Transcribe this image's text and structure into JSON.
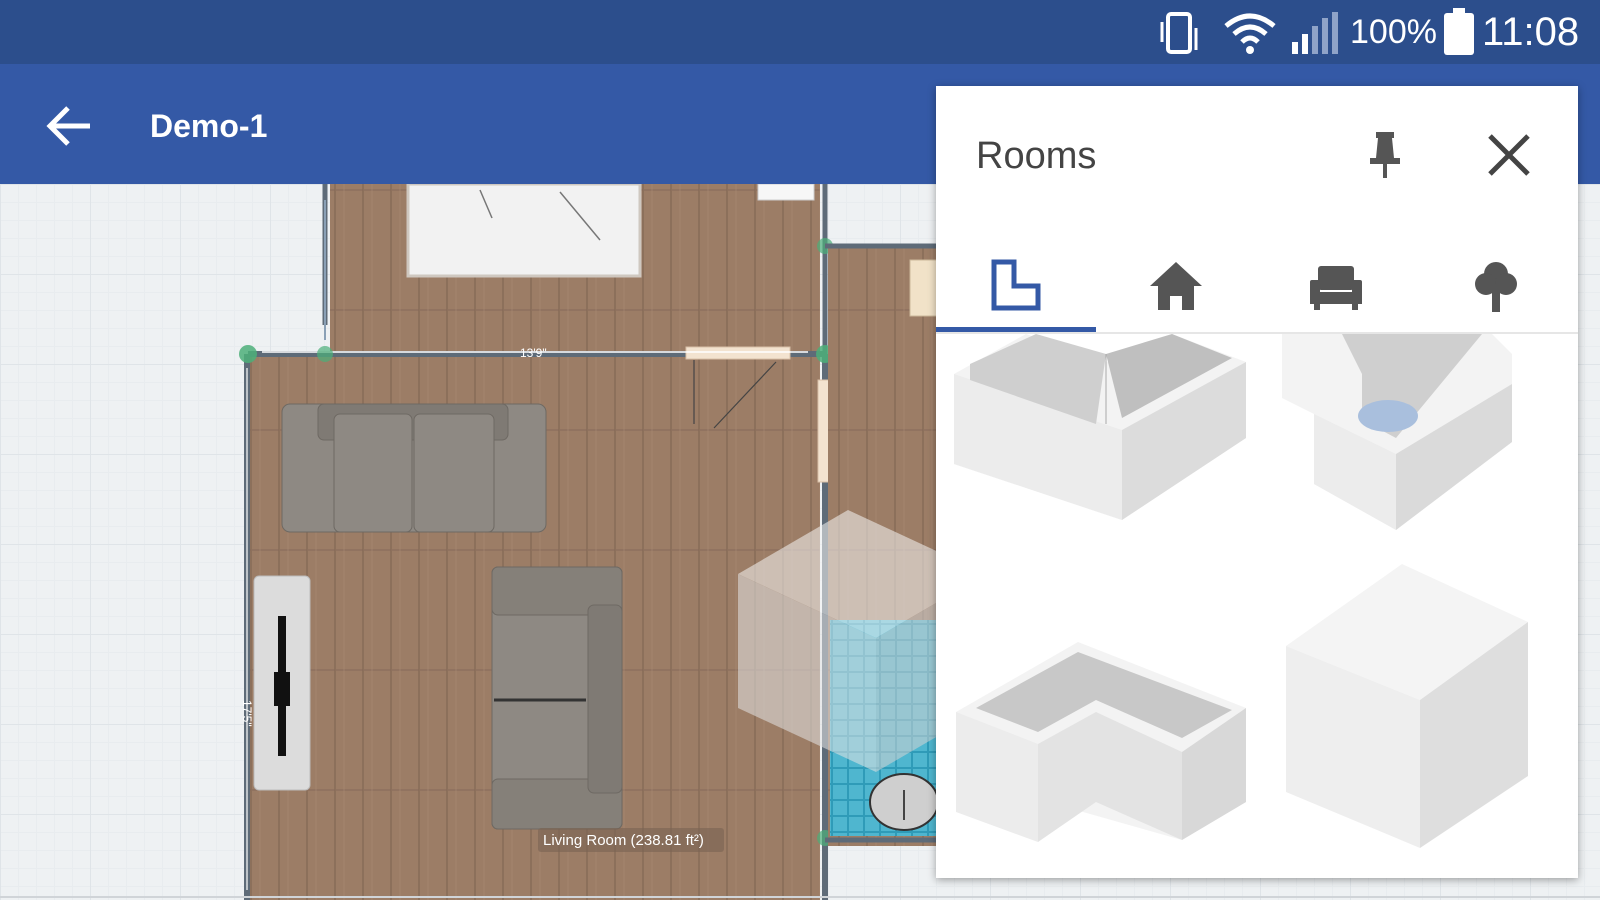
{
  "status_bar": {
    "battery_percent_text": "100%",
    "time": "11:08",
    "icons": [
      "vibrate-icon",
      "wifi-icon",
      "cell-signal-icon",
      "battery-icon"
    ]
  },
  "app_bar": {
    "title": "Demo-1",
    "back_icon": "arrow-left-icon",
    "color": "#3459a6"
  },
  "floor_plan": {
    "room_label": "Living Room (238.81 ft²)",
    "dimensions": {
      "top_wall": "13'9\"",
      "left_wall": "17'5\""
    }
  },
  "rooms_panel": {
    "title": "Rooms",
    "pin_icon": "pin-icon",
    "close_icon": "close-icon",
    "tabs": [
      {
        "name": "rooms",
        "icon": "room-shape-icon",
        "selected": true
      },
      {
        "name": "buildings",
        "icon": "house-icon",
        "selected": false
      },
      {
        "name": "furniture",
        "icon": "sofa-icon",
        "selected": false
      },
      {
        "name": "outdoor",
        "icon": "tree-icon",
        "selected": false
      }
    ],
    "items": [
      {
        "name": "l-shaped-room-tile"
      },
      {
        "name": "notched-room-tile"
      },
      {
        "name": "corner-room-tile"
      },
      {
        "name": "solid-block-tile"
      }
    ]
  },
  "colors": {
    "status_bar": "#2c4e8c",
    "accent": "#3459a6",
    "floor_wood": "#9c7d66",
    "grid": "#eef1f3"
  }
}
